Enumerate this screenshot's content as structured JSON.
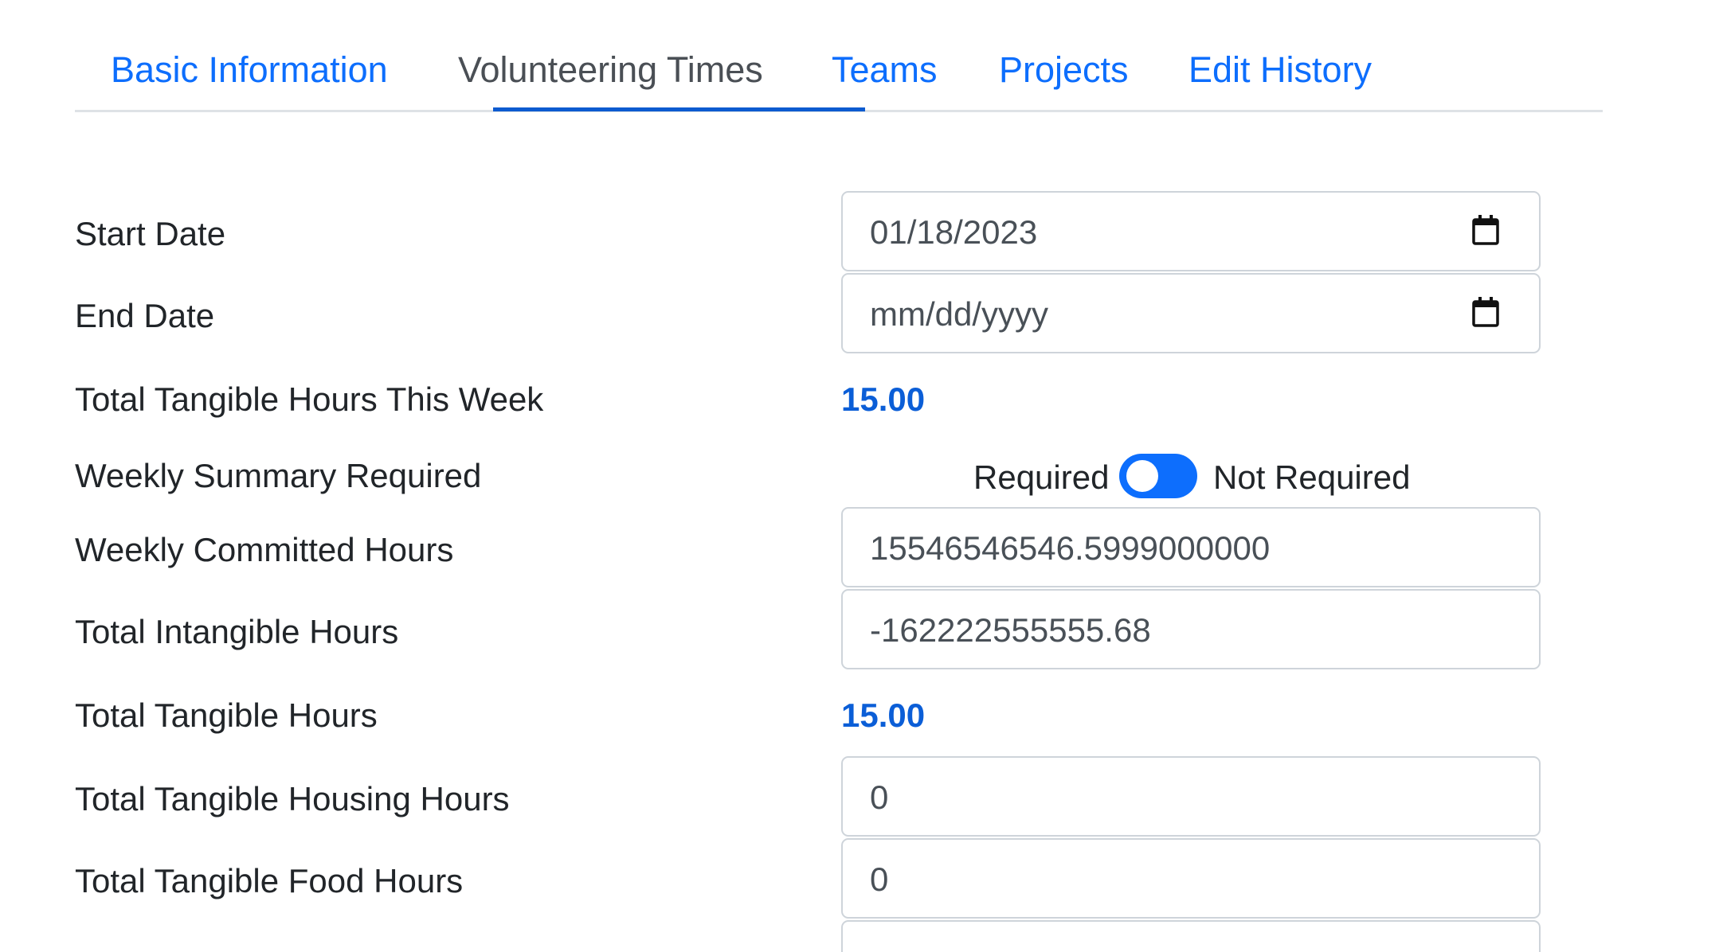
{
  "tabs": [
    {
      "label": "Basic Information"
    },
    {
      "label": "Volunteering Times"
    },
    {
      "label": "Teams"
    },
    {
      "label": "Projects"
    },
    {
      "label": "Edit History"
    }
  ],
  "active_tab": "Volunteering Times",
  "form": {
    "start_date": {
      "label": "Start Date",
      "value": "01/18/2023"
    },
    "end_date": {
      "label": "End Date",
      "placeholder": "mm/dd/yyyy"
    },
    "tangible_this_week": {
      "label": "Total Tangible Hours This Week",
      "value": "15.00"
    },
    "weekly_summary": {
      "label": "Weekly Summary Required",
      "left_option": "Required",
      "right_option": "Not Required"
    },
    "weekly_committed": {
      "label": "Weekly Committed Hours",
      "value": "15546546546.5999000000"
    },
    "intangible": {
      "label": "Total Intangible Hours",
      "value": "-162222555555.68"
    },
    "tangible_total": {
      "label": "Total Tangible Hours",
      "value": "15.00"
    },
    "housing": {
      "label": "Total Tangible Housing Hours",
      "value": "0"
    },
    "food": {
      "label": "Total Tangible Food Hours",
      "value": "0"
    }
  },
  "colors": {
    "link": "#0d6efd",
    "value_blue": "#0b5ed7",
    "toggle": "#0d6efd"
  }
}
